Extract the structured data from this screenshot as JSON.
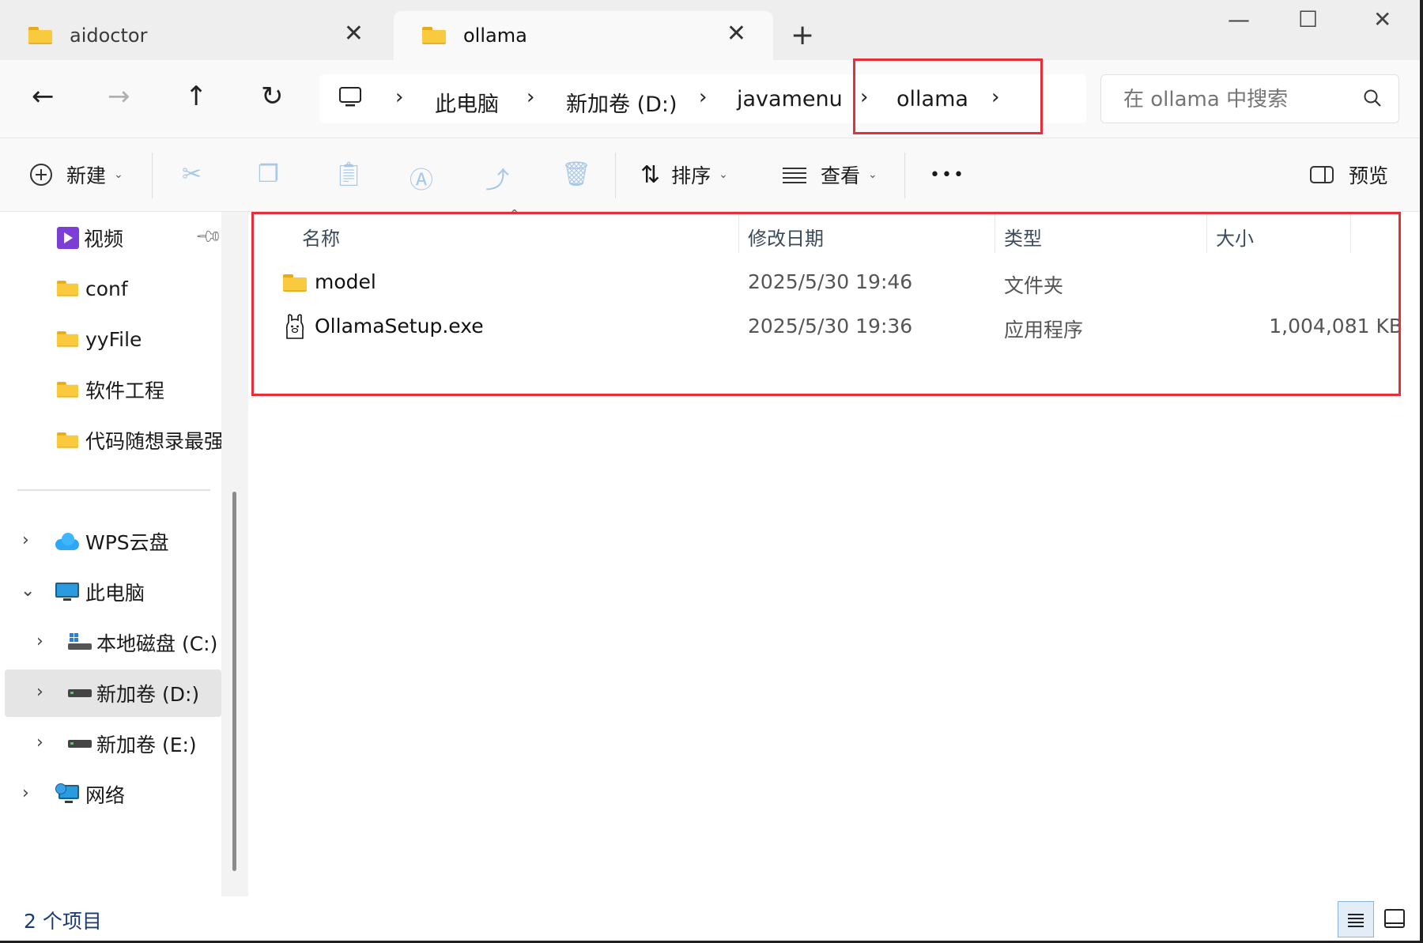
{
  "tabs": [
    {
      "label": "aidoctor",
      "active": false
    },
    {
      "label": "ollama",
      "active": true
    }
  ],
  "window_controls": {
    "minimize": "—",
    "maximize": "☐",
    "close": "✕"
  },
  "tab_close": "✕",
  "new_tab": "+",
  "nav": {
    "back": "←",
    "forward": "→",
    "up": "↑",
    "refresh": "↻"
  },
  "breadcrumb": [
    "此电脑",
    "新加卷 (D:)",
    "javamenu",
    "ollama"
  ],
  "search": {
    "placeholder": "在 ollama 中搜索"
  },
  "toolbar": {
    "new_label": "新建",
    "sort_label": "排序",
    "view_label": "查看",
    "more": "•••",
    "preview_label": "预览"
  },
  "sidebar": {
    "quick_access": [
      {
        "label": "视频",
        "icon": "video-folder-icon",
        "pinned": true
      },
      {
        "label": "conf",
        "icon": "folder-icon"
      },
      {
        "label": "yyFile",
        "icon": "folder-icon"
      },
      {
        "label": "软件工程",
        "icon": "folder-icon"
      },
      {
        "label": "代码随想录最强/",
        "icon": "folder-icon"
      }
    ],
    "tree": [
      {
        "label": "WPS云盘",
        "icon": "cloud-icon",
        "expanded": false
      },
      {
        "label": "此电脑",
        "icon": "computer-icon",
        "expanded": true
      },
      {
        "label": "本地磁盘 (C:)",
        "icon": "windows-drive-icon",
        "expanded": false
      },
      {
        "label": "新加卷 (D:)",
        "icon": "drive-icon",
        "expanded": false,
        "selected": true
      },
      {
        "label": "新加卷 (E:)",
        "icon": "drive-icon",
        "expanded": false
      },
      {
        "label": "网络",
        "icon": "network-icon",
        "expanded": false
      }
    ]
  },
  "columns": {
    "name": "名称",
    "modified": "修改日期",
    "type": "类型",
    "size": "大小"
  },
  "files": [
    {
      "name": "model",
      "modified": "2025/5/30 19:46",
      "type": "文件夹",
      "size": "",
      "icon": "folder-icon"
    },
    {
      "name": "OllamaSetup.exe",
      "modified": "2025/5/30 19:36",
      "type": "应用程序",
      "size": "1,004,081 KB",
      "icon": "ollama-icon"
    }
  ],
  "status": {
    "item_count": "2 个项目"
  },
  "colors": {
    "highlight": "#e5303a",
    "selected_bg": "#e5e5e5",
    "accent": "#0067c0"
  }
}
